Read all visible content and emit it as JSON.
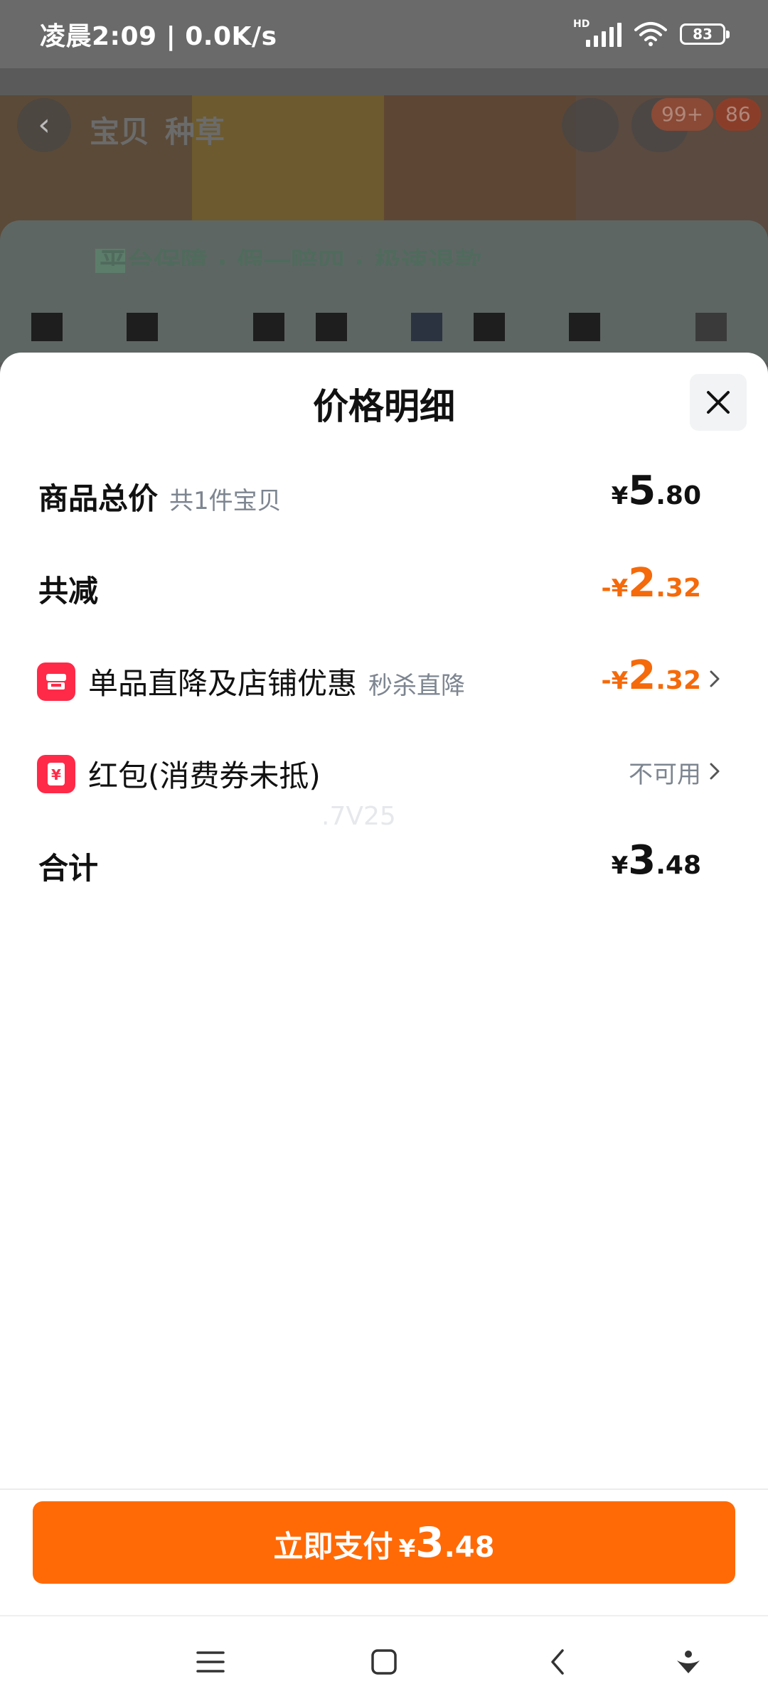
{
  "status_bar": {
    "time": "凌晨2:09 | 0.0K/s",
    "network": "HD",
    "battery": "83"
  },
  "background_page": {
    "tab_1": "宝贝",
    "tab_2": "种草",
    "cart_badge": "99+",
    "badge_2": "86",
    "guarantee_text": "平台保障 · 假一赔四 · 极速退款"
  },
  "sheet": {
    "title": "价格明细",
    "rows": [
      {
        "label": "商品总价",
        "sub": "共1件宝贝",
        "currency": "¥",
        "int": "5",
        "dec": ".80"
      },
      {
        "label": "共减",
        "sub": "",
        "currency": "-¥",
        "int": "2",
        "dec": ".32"
      },
      {
        "label": "单品直降及店铺优惠",
        "sub": "秒杀直降",
        "currency": "-¥",
        "int": "2",
        "dec": ".32"
      },
      {
        "label": "红包(消费券未抵)",
        "sub": "",
        "status": "不可用"
      },
      {
        "label": "合计",
        "sub": "",
        "currency": "¥",
        "int": "3",
        "dec": ".48"
      }
    ],
    "watermark": ".7V25"
  },
  "pay_button": {
    "label": "立即支付",
    "currency": "¥",
    "int": "3",
    "dec": ".48"
  },
  "icons": {
    "close": "close-icon",
    "shop": "shop-icon",
    "red_packet": "yen-icon",
    "chevron": "chevron-right-icon"
  },
  "colors": {
    "accent_orange": "#ff6a07",
    "discount_orange": "#f56a0a",
    "icon_red": "#ff2a48",
    "secondary_text": "#7d8590"
  }
}
